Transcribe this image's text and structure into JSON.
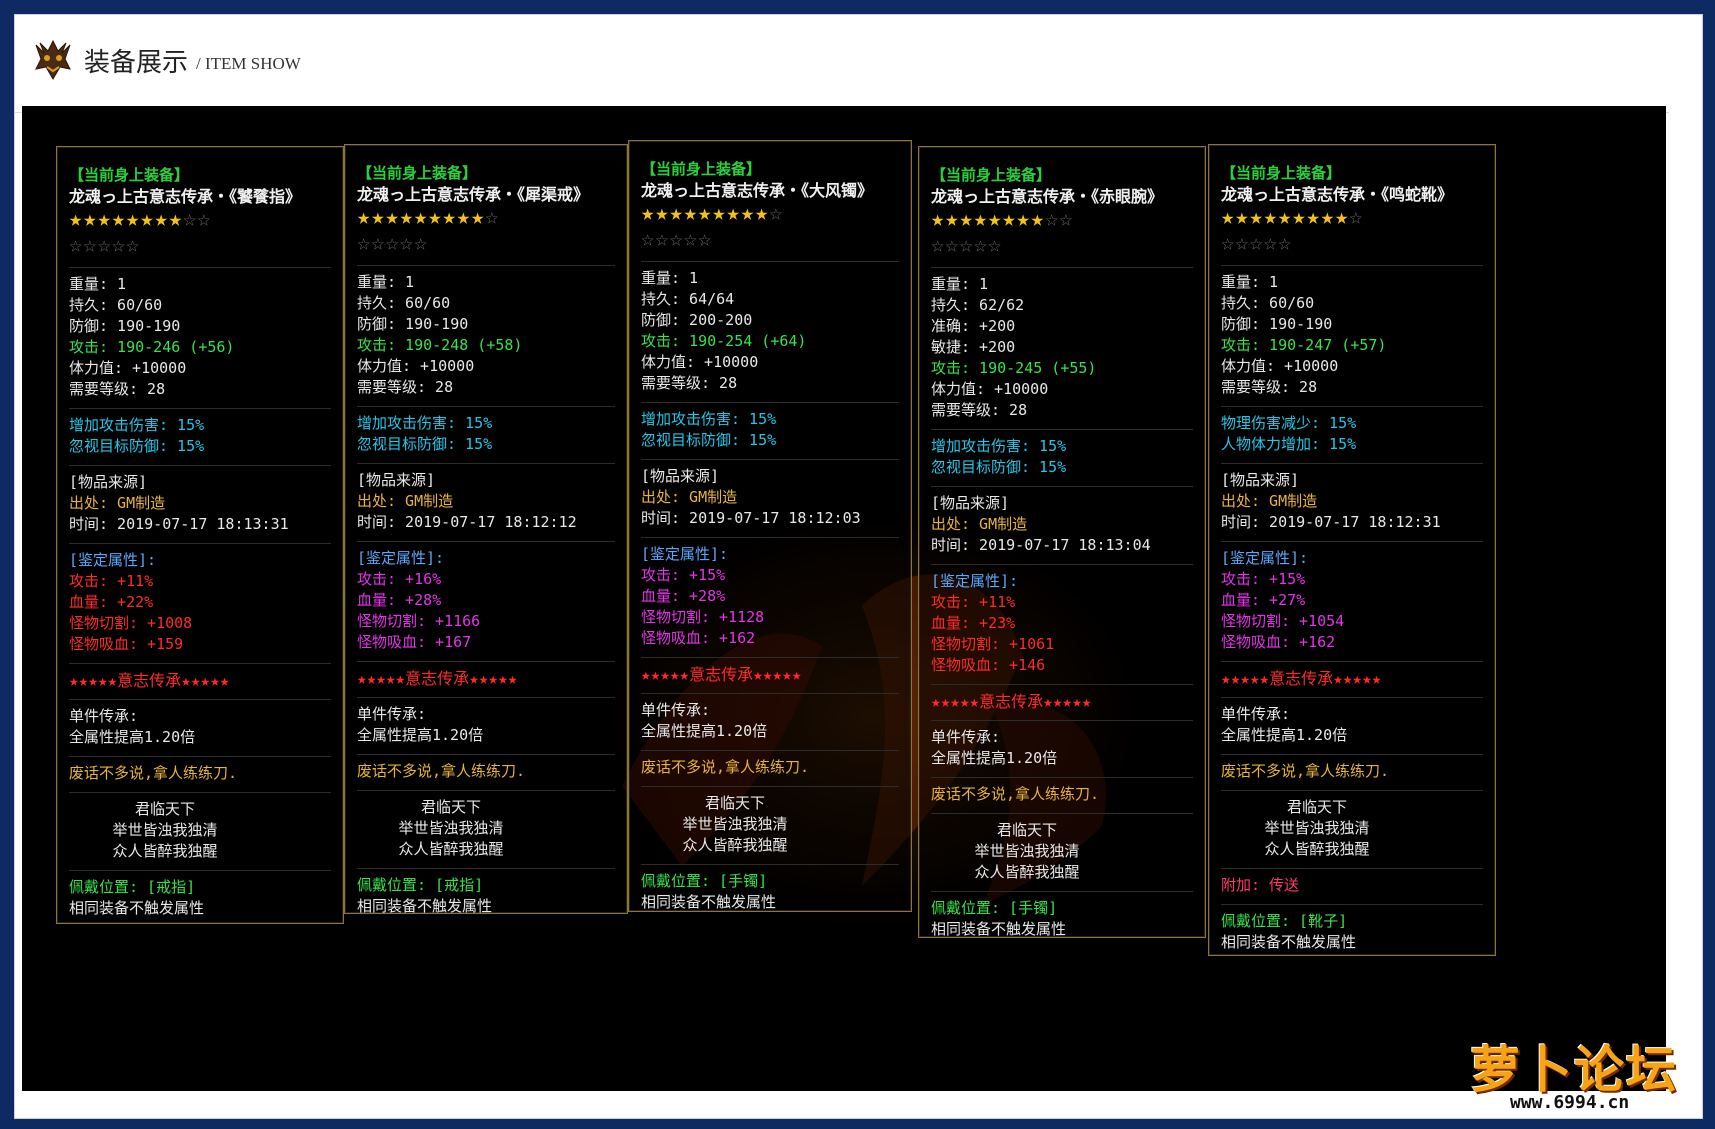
{
  "header": {
    "title": "装备展示",
    "subtitle": "/ ITEM SHOW"
  },
  "watermark": {
    "brand": "萝卜论坛",
    "url": "www.6994.cn"
  },
  "panels": [
    {
      "tag": "【当前身上装备】",
      "name": "龙魂っ上古意志传承・《饕餮指》",
      "stars_gold": "★★★★★★★★",
      "stars_empty": "☆☆",
      "stars_row2": "☆☆☆☆☆",
      "stats": [
        {
          "label": "重量: 1",
          "cls": "k"
        },
        {
          "label": "持久: 60/60",
          "cls": "k"
        },
        {
          "label": "防御: 190-190",
          "cls": "k"
        },
        {
          "label": "攻击: 190-246 (+56)",
          "cls": "g"
        },
        {
          "label": "体力值: +10000",
          "cls": "k"
        },
        {
          "label": "需要等级: 28",
          "cls": "k"
        }
      ],
      "bonus": [
        {
          "label": "增加攻击伤害: 15%",
          "cls": "cyan"
        },
        {
          "label": "忽视目标防御: 15%",
          "cls": "cyan"
        }
      ],
      "source": [
        "[物品来源]",
        "出处: GM制造",
        "时间: 2019-07-17 18:13:31"
      ],
      "appraise_title": "[鉴定属性]:",
      "appraise": [
        {
          "label": "攻击: +11%",
          "cls": "red"
        },
        {
          "label": "血量: +22%",
          "cls": "red"
        },
        {
          "label": "怪物切割: +1008",
          "cls": "red"
        },
        {
          "label": "怪物吸血: +159",
          "cls": "red"
        }
      ],
      "legacy_line": "★★★★★意志传承★★★★★",
      "single_title": "单件传承:",
      "single_value": "全属性提高1.20倍",
      "flavor": "废话不多说,拿人练练刀.",
      "poem": [
        "君临天下",
        "举世皆浊我独清",
        "众人皆醉我独醒"
      ],
      "extra": "",
      "slot": "佩戴位置: [戒指]",
      "note": "相同装备不触发属性"
    },
    {
      "tag": "【当前身上装备】",
      "name": "龙魂っ上古意志传承・《犀渠戒》",
      "stars_gold": "★★★★★★★★★",
      "stars_empty": "☆",
      "stars_row2": "☆☆☆☆☆",
      "stats": [
        {
          "label": "重量: 1",
          "cls": "k"
        },
        {
          "label": "持久: 60/60",
          "cls": "k"
        },
        {
          "label": "防御: 190-190",
          "cls": "k"
        },
        {
          "label": "攻击: 190-248 (+58)",
          "cls": "g"
        },
        {
          "label": "体力值: +10000",
          "cls": "k"
        },
        {
          "label": "需要等级: 28",
          "cls": "k"
        }
      ],
      "bonus": [
        {
          "label": "增加攻击伤害: 15%",
          "cls": "cyan"
        },
        {
          "label": "忽视目标防御: 15%",
          "cls": "cyan"
        }
      ],
      "source": [
        "[物品来源]",
        "出处: GM制造",
        "时间: 2019-07-17 18:12:12"
      ],
      "appraise_title": "[鉴定属性]:",
      "appraise": [
        {
          "label": "攻击: +16%",
          "cls": "mag"
        },
        {
          "label": "血量: +28%",
          "cls": "mag"
        },
        {
          "label": "怪物切割: +1166",
          "cls": "mag"
        },
        {
          "label": "怪物吸血: +167",
          "cls": "mag"
        }
      ],
      "legacy_line": "★★★★★意志传承★★★★★",
      "single_title": "单件传承:",
      "single_value": "全属性提高1.20倍",
      "flavor": "废话不多说,拿人练练刀.",
      "poem": [
        "君临天下",
        "举世皆浊我独清",
        "众人皆醉我独醒"
      ],
      "extra": "",
      "slot": "佩戴位置: [戒指]",
      "note": "相同装备不触发属性"
    },
    {
      "tag": "【当前身上装备】",
      "name": "龙魂っ上古意志传承・《大风镯》",
      "stars_gold": "★★★★★★★★★",
      "stars_empty": "☆",
      "stars_row2": "☆☆☆☆☆",
      "stats": [
        {
          "label": "重量: 1",
          "cls": "k"
        },
        {
          "label": "持久: 64/64",
          "cls": "k"
        },
        {
          "label": "防御: 200-200",
          "cls": "k"
        },
        {
          "label": "攻击: 190-254 (+64)",
          "cls": "g"
        },
        {
          "label": "体力值: +10000",
          "cls": "k"
        },
        {
          "label": "需要等级: 28",
          "cls": "k"
        }
      ],
      "bonus": [
        {
          "label": "增加攻击伤害: 15%",
          "cls": "cyan"
        },
        {
          "label": "忽视目标防御: 15%",
          "cls": "cyan"
        }
      ],
      "source": [
        "[物品来源]",
        "出处: GM制造",
        "时间: 2019-07-17 18:12:03"
      ],
      "appraise_title": "[鉴定属性]:",
      "appraise": [
        {
          "label": "攻击: +15%",
          "cls": "mag"
        },
        {
          "label": "血量: +28%",
          "cls": "mag"
        },
        {
          "label": "怪物切割: +1128",
          "cls": "mag"
        },
        {
          "label": "怪物吸血: +162",
          "cls": "mag"
        }
      ],
      "legacy_line": "★★★★★意志传承★★★★★",
      "single_title": "单件传承:",
      "single_value": "全属性提高1.20倍",
      "flavor": "废话不多说,拿人练练刀.",
      "poem": [
        "君临天下",
        "举世皆浊我独清",
        "众人皆醉我独醒"
      ],
      "extra": "",
      "slot": "佩戴位置: [手镯]",
      "note": "相同装备不触发属性"
    },
    {
      "tag": "【当前身上装备】",
      "name": "龙魂っ上古意志传承・《赤眼腕》",
      "stars_gold": "★★★★★★★★",
      "stars_empty": "☆☆",
      "stars_row2": "☆☆☆☆☆",
      "stats": [
        {
          "label": "重量: 1",
          "cls": "k"
        },
        {
          "label": "持久: 62/62",
          "cls": "k"
        },
        {
          "label": "准确: +200",
          "cls": "k"
        },
        {
          "label": "敏捷: +200",
          "cls": "k"
        },
        {
          "label": "攻击: 190-245 (+55)",
          "cls": "g"
        },
        {
          "label": "体力值: +10000",
          "cls": "k"
        },
        {
          "label": "需要等级: 28",
          "cls": "k"
        }
      ],
      "bonus": [
        {
          "label": "增加攻击伤害: 15%",
          "cls": "cyan"
        },
        {
          "label": "忽视目标防御: 15%",
          "cls": "cyan"
        }
      ],
      "source": [
        "[物品来源]",
        "出处: GM制造",
        "时间: 2019-07-17 18:13:04"
      ],
      "appraise_title": "[鉴定属性]:",
      "appraise": [
        {
          "label": "攻击: +11%",
          "cls": "red"
        },
        {
          "label": "血量: +23%",
          "cls": "red"
        },
        {
          "label": "怪物切割: +1061",
          "cls": "red"
        },
        {
          "label": "怪物吸血: +146",
          "cls": "red"
        }
      ],
      "legacy_line": "★★★★★意志传承★★★★★",
      "single_title": "单件传承:",
      "single_value": "全属性提高1.20倍",
      "flavor": "废话不多说,拿人练练刀.",
      "poem": [
        "君临天下",
        "举世皆浊我独清",
        "众人皆醉我独醒"
      ],
      "extra": "",
      "slot": "佩戴位置: [手镯]",
      "note": "相同装备不触发属性"
    },
    {
      "tag": "【当前身上装备】",
      "name": "龙魂っ上古意志传承・《鸣蛇靴》",
      "stars_gold": "★★★★★★★★★",
      "stars_empty": "☆",
      "stars_row2": "☆☆☆☆☆",
      "stats": [
        {
          "label": "重量: 1",
          "cls": "k"
        },
        {
          "label": "持久: 60/60",
          "cls": "k"
        },
        {
          "label": "防御: 190-190",
          "cls": "k"
        },
        {
          "label": "攻击: 190-247 (+57)",
          "cls": "g"
        },
        {
          "label": "体力值: +10000",
          "cls": "k"
        },
        {
          "label": "需要等级: 28",
          "cls": "k"
        }
      ],
      "bonus": [
        {
          "label": "物理伤害减少: 15%",
          "cls": "cyan"
        },
        {
          "label": "人物体力增加: 15%",
          "cls": "cyan"
        }
      ],
      "source": [
        "[物品来源]",
        "出处: GM制造",
        "时间: 2019-07-17 18:12:31"
      ],
      "appraise_title": "[鉴定属性]:",
      "appraise": [
        {
          "label": "攻击: +15%",
          "cls": "mag"
        },
        {
          "label": "血量: +27%",
          "cls": "mag"
        },
        {
          "label": "怪物切割: +1054",
          "cls": "mag"
        },
        {
          "label": "怪物吸血: +162",
          "cls": "mag"
        }
      ],
      "legacy_line": "★★★★★意志传承★★★★★",
      "single_title": "单件传承:",
      "single_value": "全属性提高1.20倍",
      "flavor": "废话不多说,拿人练练刀.",
      "poem": [
        "君临天下",
        "举世皆浊我独清",
        "众人皆醉我独醒"
      ],
      "extra": "附加: 传送",
      "slot": "佩戴位置: [靴子]",
      "note": "相同装备不触发属性"
    }
  ]
}
